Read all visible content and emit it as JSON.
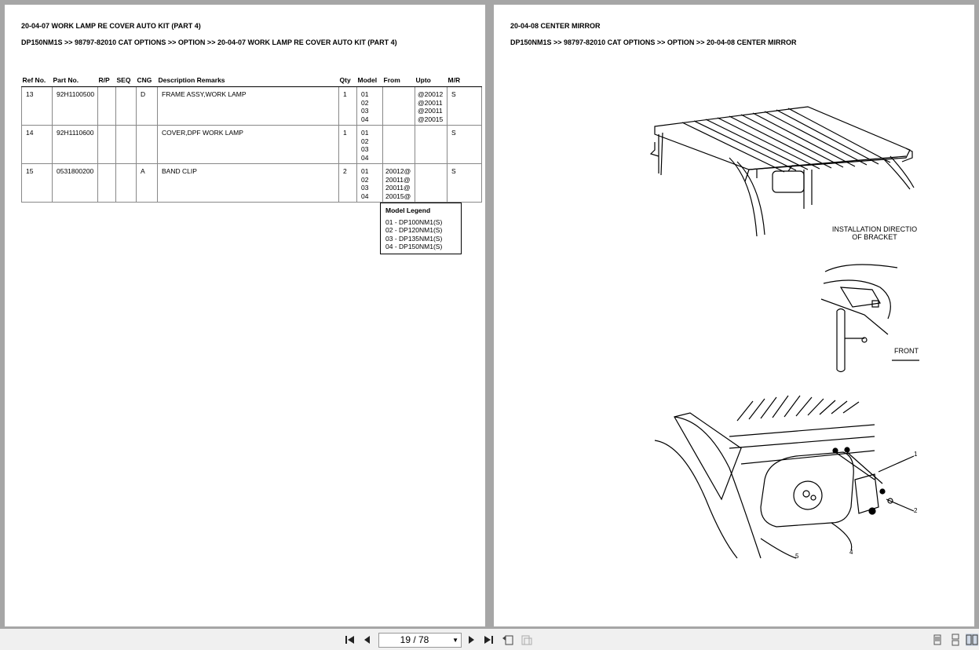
{
  "left_page": {
    "title": "20-04-07 WORK LAMP RE COVER AUTO KIT (PART 4)",
    "breadcrumb": "DP150NM1S >> 98797-82010 CAT OPTIONS >> OPTION >> 20-04-07 WORK LAMP RE COVER AUTO KIT (PART 4)",
    "columns": [
      "Ref No.",
      "Part No.",
      "R/P",
      "SEQ",
      "CNG",
      "Description Remarks",
      "Qty",
      "Model",
      "From",
      "Upto",
      "M/R"
    ],
    "rows": [
      {
        "ref": "13",
        "part": "92H1100500",
        "rp": "",
        "seq": "",
        "cng": "D",
        "desc": "FRAME ASSY,WORK LAMP",
        "qty": "1",
        "model": "01\n02\n03\n04",
        "from": "",
        "upto": "@20012\n@20011\n@20011\n@20015",
        "mr": "S"
      },
      {
        "ref": "14",
        "part": "92H1110600",
        "rp": "",
        "seq": "",
        "cng": "",
        "desc": "COVER,DPF WORK LAMP",
        "qty": "1",
        "model": "01\n02\n03\n04",
        "from": "",
        "upto": "",
        "mr": "S"
      },
      {
        "ref": "15",
        "part": "0531800200",
        "rp": "",
        "seq": "",
        "cng": "A",
        "desc": "BAND CLIP",
        "qty": "2",
        "model": "01\n02\n03\n04",
        "from": "20012@\n20011@\n20011@\n20015@",
        "upto": "",
        "mr": "S"
      }
    ],
    "legend": {
      "title": "Model Legend",
      "items": [
        "01 - DP100NM1(S)",
        "02 - DP120NM1(S)",
        "03 - DP135NM1(S)",
        "04 - DP150NM1(S)"
      ]
    }
  },
  "right_page": {
    "title": "20-04-08 CENTER MIRROR",
    "breadcrumb": "DP150NM1S >> 98797-82010 CAT OPTIONS >> OPTION >> 20-04-08 CENTER MIRROR",
    "caption_line1": "INSTALLATION DIRECTIO",
    "caption_line2": "OF BRACKET",
    "front_label": "FRONT",
    "callouts": [
      "1",
      "2",
      "4",
      "5"
    ]
  },
  "toolbar": {
    "page_indicator": "19 / 78",
    "icons": [
      "first-page-icon",
      "prev-page-icon",
      "next-page-icon",
      "last-page-icon",
      "previous-view-icon",
      "next-view-icon",
      "single-page-view-icon",
      "continuous-view-icon",
      "two-page-view-icon"
    ]
  }
}
